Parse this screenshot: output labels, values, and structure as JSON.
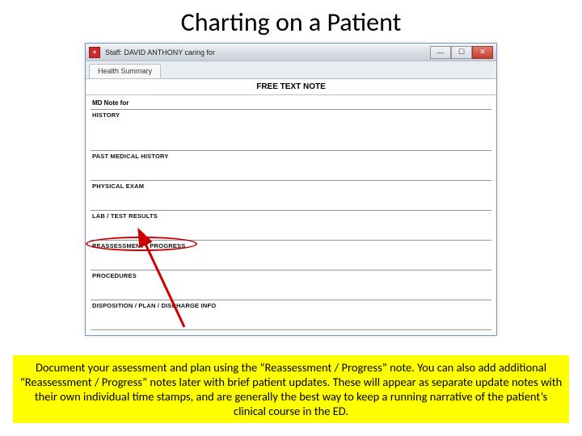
{
  "slide": {
    "title": "Charting on a Patient"
  },
  "window": {
    "title": "Staff: DAVID ANTHONY caring for",
    "app_icon_text": "+",
    "controls": {
      "min": "—",
      "max": "☐",
      "close": "✕"
    },
    "tab_label": "Health Summary",
    "doc_header": "FREE TEXT NOTE",
    "md_note_label": "MD Note for",
    "sections": {
      "history": "HISTORY",
      "pmh": "PAST MEDICAL HISTORY",
      "pe": "PHYSICAL EXAM",
      "lab": "LAB / TEST RESULTS",
      "reassess": "REASSESSMENT / PROGRESS",
      "proc": "PROCEDURES",
      "dispo": "DISPOSITION / PLAN / DISCHARGE INFO"
    }
  },
  "caption": "Document your assessment and plan using the “Reassessment / Progress” note. You can also add additional “Reassessment / Progress” notes later with brief patient updates. These will appear as separate update notes with their own individual time stamps, and are generally the best way to keep a running narrative of the patient’s clinical course in the ED.",
  "annotation": {
    "highlight_target": "reassessment-section",
    "arrow_color": "#cc0000"
  }
}
